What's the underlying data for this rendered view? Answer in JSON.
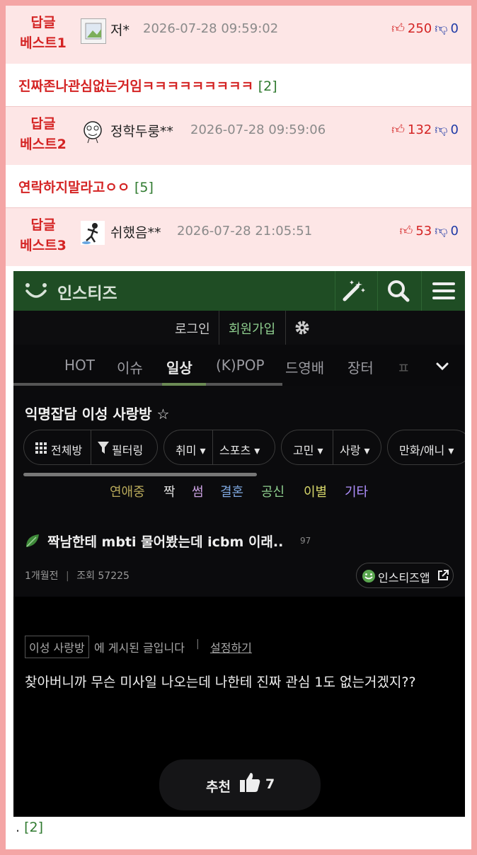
{
  "best_comments": [
    {
      "tag_line1": "답글",
      "tag_line2": "베스트1",
      "nick": "저*",
      "date": "2026-07-28 09:59:02",
      "up": "250",
      "down": "0",
      "comment": "진짜존나관심없는거임ㅋㅋㅋㅋㅋㅋㅋㅋㅋ",
      "replies": "[2]"
    },
    {
      "tag_line1": "답글",
      "tag_line2": "베스트2",
      "nick": "정학두룽**",
      "date": "2026-07-28 09:59:06",
      "up": "132",
      "down": "0",
      "comment": "연락하지말라고ㅇㅇ",
      "replies": "[5]"
    },
    {
      "tag_line1": "답글",
      "tag_line2": "베스트3",
      "nick": "쉬했음**",
      "date": "2026-07-28 21:05:51",
      "up": "53",
      "down": "0"
    }
  ],
  "screenshot": {
    "brand": "인스티즈",
    "login": "로그인",
    "signup": "회원가입",
    "tabs": [
      "HOT",
      "이슈",
      "일상",
      "(K)POP",
      "드영배",
      "장터",
      "ㅍ"
    ],
    "board_title": "익명잡담 이성 사랑방 ☆",
    "pills": [
      "전체방",
      "필터링",
      "취미 ▾",
      "스포츠 ▾",
      "고민 ▾",
      "사랑 ▾",
      "만화/애니 ▾"
    ],
    "categories": [
      "연애중",
      "짝",
      "썸",
      "결혼",
      "공신",
      "이별",
      "기타"
    ],
    "category_colors": [
      "#b8a95a",
      "#e0e0e0",
      "#c9a0e0",
      "#7fa8e0",
      "#8fcf8f",
      "#d8d86a",
      "#b090ff"
    ],
    "post_title": "짝남한테 mbti 물어봤는데 icbm 이래..",
    "post_comment_count": "97",
    "post_time": "1개월전",
    "post_sep": "|",
    "post_views": "조회 57225",
    "app_button": "인스티즈앱",
    "board_tag": "이성 사랑방",
    "posted_in": "에 게시된 글입니다",
    "bar": "|",
    "settings": "설정하기",
    "content": "찾아버니까 무슨 미사일 나오는데 나한테 진짜 관심 1도 없는거겠지??",
    "recommend": "추천",
    "recommend_count": "7"
  },
  "footer": {
    "dot": ".",
    "replies": "[2]"
  }
}
